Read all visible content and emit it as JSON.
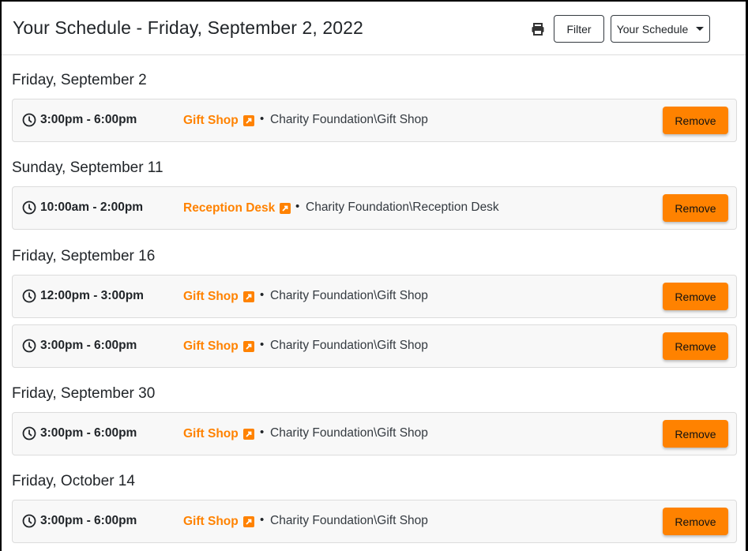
{
  "header": {
    "title": "Your Schedule - Friday, September 2, 2022",
    "print_icon": "printer-icon",
    "filter_label": "Filter",
    "schedule_dropdown": {
      "selected": "Your Schedule",
      "icon": "caret-down-icon"
    }
  },
  "colors": {
    "accent": "#ff8200",
    "card_bg": "#f8f8f8",
    "border": "#dcdcdc",
    "text": "#212529"
  },
  "days": [
    {
      "heading": "Friday, September 2",
      "shifts": [
        {
          "time": "3:00pm - 6:00pm",
          "location": "Gift Shop",
          "separator": "•",
          "path": "Charity Foundation\\Gift Shop",
          "action": "Remove"
        }
      ]
    },
    {
      "heading": "Sunday, September 11",
      "shifts": [
        {
          "time": "10:00am - 2:00pm",
          "location": "Reception Desk",
          "separator": "•",
          "path": "Charity Foundation\\Reception Desk",
          "action": "Remove"
        }
      ]
    },
    {
      "heading": "Friday, September 16",
      "shifts": [
        {
          "time": "12:00pm - 3:00pm",
          "location": "Gift Shop",
          "separator": "•",
          "path": "Charity Foundation\\Gift Shop",
          "action": "Remove"
        },
        {
          "time": "3:00pm - 6:00pm",
          "location": "Gift Shop",
          "separator": "•",
          "path": "Charity Foundation\\Gift Shop",
          "action": "Remove"
        }
      ]
    },
    {
      "heading": "Friday, September 30",
      "shifts": [
        {
          "time": "3:00pm - 6:00pm",
          "location": "Gift Shop",
          "separator": "•",
          "path": "Charity Foundation\\Gift Shop",
          "action": "Remove"
        }
      ]
    },
    {
      "heading": "Friday, October 14",
      "shifts": [
        {
          "time": "3:00pm - 6:00pm",
          "location": "Gift Shop",
          "separator": "•",
          "path": "Charity Foundation\\Gift Shop",
          "action": "Remove"
        }
      ]
    }
  ]
}
